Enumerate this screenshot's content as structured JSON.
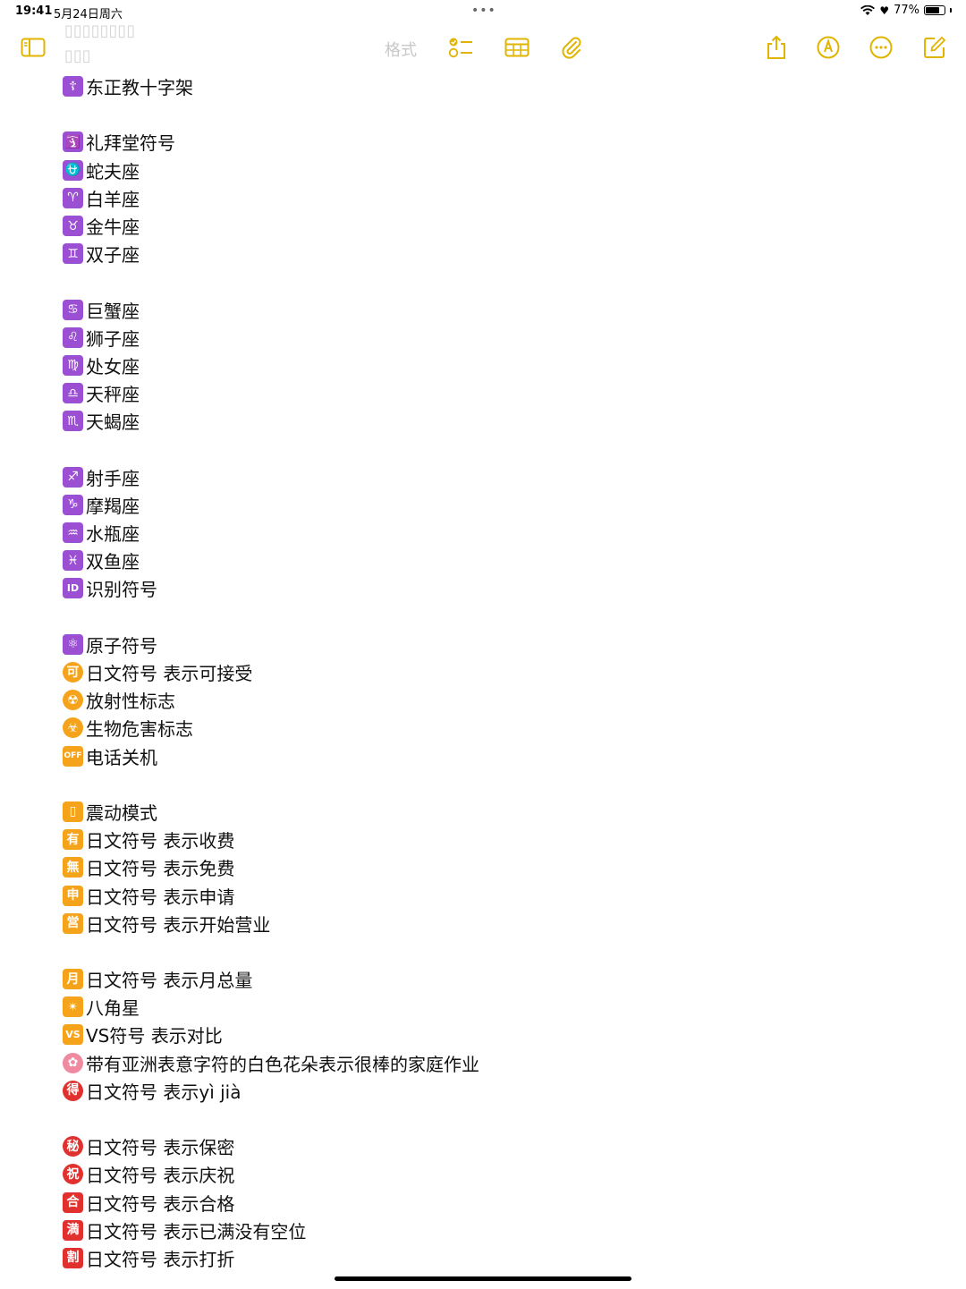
{
  "status": {
    "time": "19:41",
    "date": "5月24日周六",
    "dots": "•••",
    "battery_text": "77%",
    "battery_level": 0.77
  },
  "toolbar": {
    "format_label": "格式",
    "accent_color": "#e0b400"
  },
  "ghost": {
    "line1": "▯▯▯▯▯▯▯▯",
    "line2": "▯▯▯"
  },
  "colors": {
    "purple": "#9b4fd3",
    "orange": "#f5a31a",
    "red": "#e0312f",
    "pink": "#f08aa0"
  },
  "entries": [
    {
      "glyph": "☦",
      "color": "purple",
      "text": "东正教十字架"
    },
    {
      "gap": true
    },
    {
      "glyph": "🛐",
      "color": "purple",
      "text": "礼拜堂符号",
      "icon": "place-of-worship-icon"
    },
    {
      "glyph": "⛎",
      "color": "purple",
      "text": "蛇夫座"
    },
    {
      "glyph": "♈",
      "color": "purple",
      "text": "白羊座"
    },
    {
      "glyph": "♉",
      "color": "purple",
      "text": "金牛座"
    },
    {
      "glyph": "♊",
      "color": "purple",
      "text": "双子座"
    },
    {
      "gap": true
    },
    {
      "glyph": "♋",
      "color": "purple",
      "text": "巨蟹座"
    },
    {
      "glyph": "♌",
      "color": "purple",
      "text": "狮子座"
    },
    {
      "glyph": "♍",
      "color": "purple",
      "text": "处女座"
    },
    {
      "glyph": "♎",
      "color": "purple",
      "text": "天秤座"
    },
    {
      "glyph": "♏",
      "color": "purple",
      "text": "天蝎座"
    },
    {
      "gap": true
    },
    {
      "glyph": "♐",
      "color": "purple",
      "text": "射手座"
    },
    {
      "glyph": "♑",
      "color": "purple",
      "text": "摩羯座"
    },
    {
      "glyph": "♒",
      "color": "purple",
      "text": "水瓶座"
    },
    {
      "glyph": "♓",
      "color": "purple",
      "text": "双鱼座"
    },
    {
      "glyph": "ID",
      "color": "purple",
      "text": "识别符号",
      "small": true
    },
    {
      "gap": true
    },
    {
      "glyph": "⚛",
      "color": "purple",
      "text": "原子符号"
    },
    {
      "glyph": "可",
      "color": "orange",
      "text": "日文符号 表示可接受",
      "round": true
    },
    {
      "glyph": "☢",
      "color": "orange",
      "text": "放射性标志",
      "round": true
    },
    {
      "glyph": "☣",
      "color": "orange",
      "text": "生物危害标志",
      "round": true
    },
    {
      "glyph": "OFF",
      "color": "orange",
      "text": "电话关机",
      "tiny": true
    },
    {
      "gap": true
    },
    {
      "glyph": "▯",
      "color": "orange",
      "text": "震动模式",
      "icon": "vibration-mode-icon"
    },
    {
      "glyph": "有",
      "color": "orange",
      "text": "日文符号 表示收费"
    },
    {
      "glyph": "無",
      "color": "orange",
      "text": "日文符号 表示免费"
    },
    {
      "glyph": "申",
      "color": "orange",
      "text": "日文符号 表示申请"
    },
    {
      "glyph": "営",
      "color": "orange",
      "text": "日文符号 表示开始营业"
    },
    {
      "gap": true
    },
    {
      "glyph": "月",
      "color": "orange",
      "text": "日文符号 表示月总量"
    },
    {
      "glyph": "✴",
      "color": "orange",
      "text": "八角星"
    },
    {
      "glyph": "VS",
      "color": "orange",
      "text": "VS符号 表示对比",
      "small": true
    },
    {
      "glyph": "✿",
      "color": "pink",
      "text": "带有亚洲表意字符的白色花朵表示很棒的家庭作业",
      "round": true,
      "icon": "white-flower-icon"
    },
    {
      "glyph": "得",
      "color": "red",
      "text": "日文符号 表示yì jià",
      "round": true
    },
    {
      "gap": true
    },
    {
      "glyph": "秘",
      "color": "red",
      "text": "日文符号 表示保密",
      "round": true
    },
    {
      "glyph": "祝",
      "color": "red",
      "text": "日文符号 表示庆祝",
      "round": true
    },
    {
      "glyph": "合",
      "color": "red",
      "text": "日文符号 表示合格"
    },
    {
      "glyph": "満",
      "color": "red",
      "text": "日文符号 表示已满没有空位"
    },
    {
      "glyph": "割",
      "color": "red",
      "text": "日文符号 表示打折"
    }
  ]
}
